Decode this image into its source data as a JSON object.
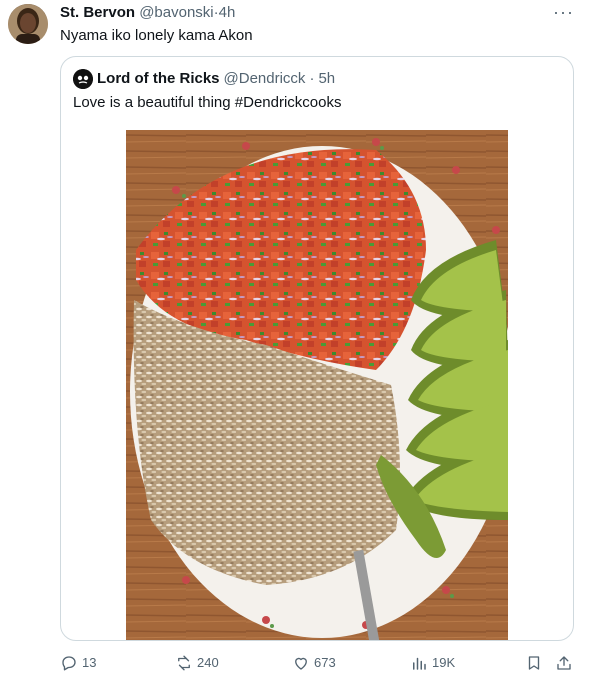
{
  "tweet": {
    "display_name": "St. Bervon",
    "handle": "@bavonski",
    "separator": "·",
    "time": "4h",
    "text": "Nyama iko lonely kama Akon",
    "more_icon": "more-horizontal-icon"
  },
  "quoted": {
    "display_name": "Lord of the Ricks",
    "handle": "@Dendricck",
    "separator": "·",
    "time": "5h",
    "text": "Love is a beautiful thing #Dendrickcooks"
  },
  "actions": {
    "replies": "13",
    "retweets": "240",
    "likes": "673",
    "views": "19K"
  },
  "colors": {
    "text_primary": "#0f1419",
    "text_secondary": "#536471",
    "border": "#cfd9de"
  }
}
